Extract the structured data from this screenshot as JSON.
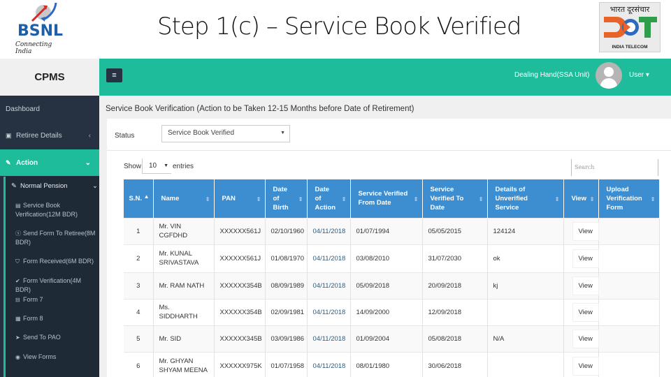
{
  "slide": {
    "title": "Step 1(c) – Service Book Verified",
    "left_logo": {
      "name": "BSNL",
      "tagline": "Connecting India"
    },
    "right_logo": {
      "hindi": "भारत दूरसंचार",
      "mark": "DOT",
      "caption": "INDIA TELECOM"
    }
  },
  "app": {
    "brand": "CPMS",
    "topbar": {
      "menu_icon": "hamburger-icon",
      "role": "Dealing Hand(SSA Unit)",
      "user_label": "User ▾"
    },
    "sidebar": {
      "items": [
        {
          "label": "Dashboard",
          "icon": ""
        },
        {
          "label": "Retiree Details",
          "icon": "id-card-icon",
          "chevron": "‹"
        },
        {
          "label": "Action",
          "icon": "edit-icon",
          "chevron": "⌄",
          "active": true
        }
      ],
      "submenu_header": {
        "label": "Normal Pension",
        "icon": "edit-icon",
        "chevron": "⌄"
      },
      "submenu": [
        {
          "label": "Service Book Verification(12M BDR)",
          "icon": "id-card-icon"
        },
        {
          "label": "Send Form To Retiree(8M BDR)",
          "icon": "dollar-circle-icon"
        },
        {
          "label": "Form Received(6M BDR)",
          "icon": "shield-icon"
        },
        {
          "label": "Form Verification(4M BDR)",
          "icon": "check-icon"
        },
        {
          "label": "Form 7",
          "icon": "form-icon"
        },
        {
          "label": "Form 8",
          "icon": "calendar-icon"
        },
        {
          "label": "Send To PAO",
          "icon": "send-icon"
        },
        {
          "label": "View Forms",
          "icon": "user-circle-icon"
        }
      ]
    },
    "main": {
      "heading": "Service Book Verification (Action to be Taken 12-15 Months before Date of Retirement)",
      "status_label": "Status",
      "status_value": "Service Book Verified",
      "show_label": "Show",
      "page_length": "10",
      "entries_label": "entries",
      "search_placeholder": "Search",
      "table": {
        "columns": [
          "S.N.",
          "Name",
          "PAN",
          "Date of Birth",
          "Date of Action",
          "Service Verified From Date",
          "Service Verified To Date",
          "Details of Unverified Service",
          "View",
          "Upload Verification Form"
        ],
        "rows": [
          {
            "sn": "1",
            "name": "Mr. VIN CGFDHD",
            "pan": "XXXXXX561J",
            "dob": "02/10/1960",
            "doa": "04/11/2018",
            "from": "01/07/1994",
            "to": "05/05/2015",
            "details": "124124",
            "view": "View",
            "upload": ""
          },
          {
            "sn": "2",
            "name": "Mr. KUNAL SRIVASTAVA",
            "pan": "XXXXXX561J",
            "dob": "01/08/1970",
            "doa": "04/11/2018",
            "from": "03/08/2010",
            "to": "31/07/2030",
            "details": "ok",
            "view": "View",
            "upload": ""
          },
          {
            "sn": "3",
            "name": "Mr. RAM NATH",
            "pan": "XXXXXX354B",
            "dob": "08/09/1989",
            "doa": "04/11/2018",
            "from": "05/09/2018",
            "to": "20/09/2018",
            "details": "kj",
            "view": "View",
            "upload": ""
          },
          {
            "sn": "4",
            "name": "Ms. SIDDHARTH",
            "pan": "XXXXXX354B",
            "dob": "02/09/1981",
            "doa": "04/11/2018",
            "from": "14/09/2000",
            "to": "12/09/2018",
            "details": "",
            "view": "View",
            "upload": ""
          },
          {
            "sn": "5",
            "name": "Mr. SID",
            "pan": "XXXXXX345B",
            "dob": "03/09/1986",
            "doa": "04/11/2018",
            "from": "01/09/2004",
            "to": "05/08/2018",
            "details": "N/A",
            "view": "View",
            "upload": ""
          },
          {
            "sn": "6",
            "name": "Mr. GHYAN SHYAM MEENA",
            "pan": "XXXXXX975K",
            "dob": "01/07/1958",
            "doa": "04/11/2018",
            "from": "08/01/1980",
            "to": "30/06/2018",
            "details": "",
            "view": "View",
            "upload": ""
          }
        ]
      }
    }
  },
  "colors": {
    "teal": "#1fbc9c",
    "sidebar": "#263241",
    "table_header": "#3d8ed1",
    "bsnl_blue": "#1f5fa8",
    "dot_orange": "#e8632a",
    "dot_green": "#2f9e4a"
  }
}
